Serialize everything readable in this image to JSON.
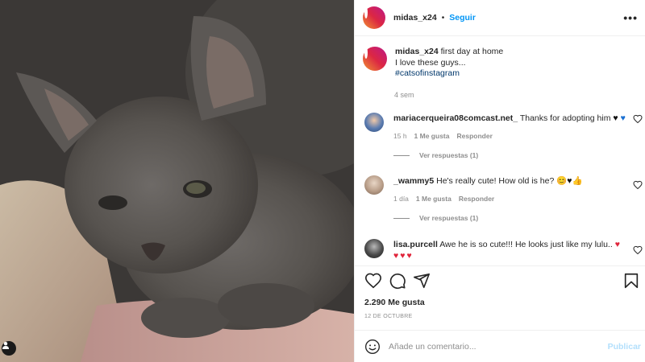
{
  "post": {
    "username": "midas_x24",
    "separator": "•",
    "follow_label": "Seguir",
    "more_icon": "more-horizontal-icon",
    "more_label": "•••"
  },
  "caption": {
    "username": "midas_x24",
    "text_line1": "first day at home",
    "text_line2": "I love these guys...",
    "hashtag": "#catsofinstagram",
    "time": "4 sem"
  },
  "comments": [
    {
      "username": "mariacerqueira08comcast.net_",
      "text": "Thanks for adopting him",
      "emojis": [
        "♥",
        "♥"
      ],
      "time": "15 h",
      "likes": "1 Me gusta",
      "reply_label": "Responder",
      "view_replies": "Ver respuestas (1)",
      "avatar_color": "#3d5a8a"
    },
    {
      "username": "_wammy5",
      "text": "He's really cute! How old is he?",
      "emojis": [
        "😊",
        "♥",
        "👍"
      ],
      "time": "1 día",
      "likes": "1 Me gusta",
      "reply_label": "Responder",
      "view_replies": "Ver respuestas (1)",
      "avatar_color": "#a08a78"
    },
    {
      "username": "lisa.purcell",
      "text": "Awe he is so cute!!! He looks just like my lulu..",
      "emojis": [
        "♥"
      ],
      "extra_hearts": "♥♥♥",
      "avatar_color": "#2c2c2c"
    }
  ],
  "actions": {
    "like_icon": "heart-icon",
    "comment_icon": "comment-icon",
    "share_icon": "share-icon",
    "save_icon": "bookmark-icon"
  },
  "likes_count": "2.290 Me gusta",
  "date": "12 DE OCTUBRE",
  "add_comment": {
    "placeholder": "Añade un comentario...",
    "publish_label": "Publicar",
    "emoji_icon": "smile-icon"
  },
  "colors": {
    "accent": "#0095f6",
    "heart_red": "#e0243a",
    "heart_blue": "#1a6fd1",
    "muted": "#8e8e8e"
  }
}
